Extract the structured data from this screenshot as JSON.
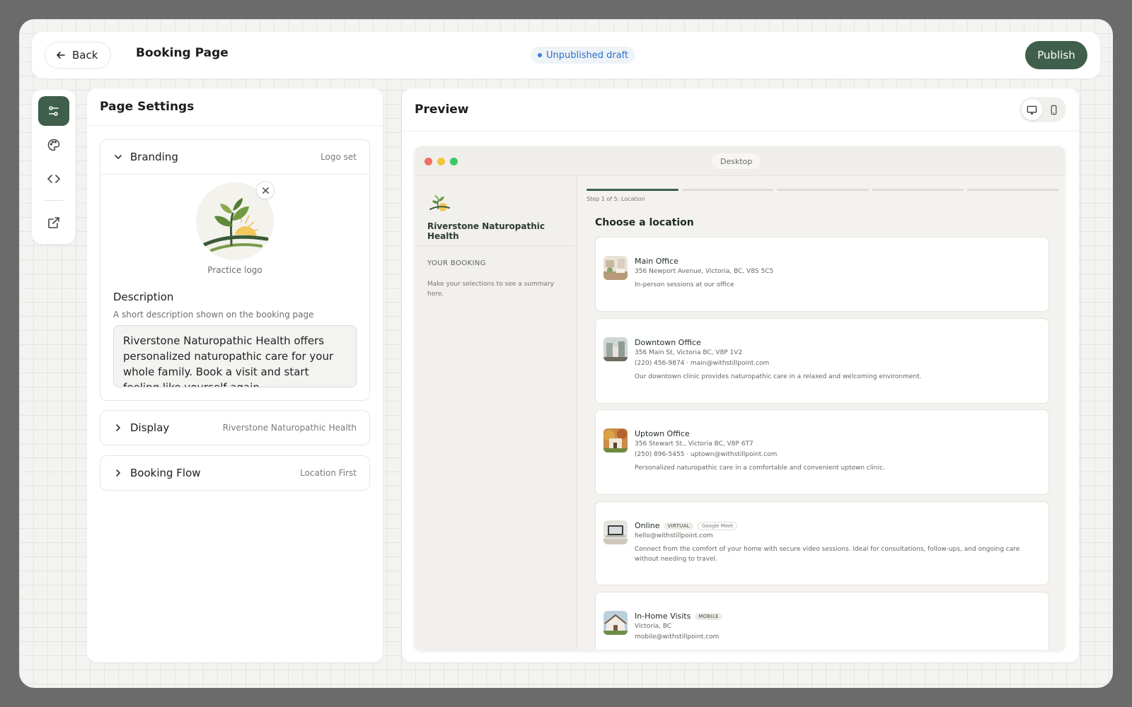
{
  "header": {
    "back_label": "Back",
    "title": "Booking Page",
    "status": "Unpublished draft",
    "publish_label": "Publish"
  },
  "rail": {
    "items": [
      "settings-icon",
      "palette-icon",
      "code-icon",
      "external-link-icon"
    ]
  },
  "settings": {
    "title": "Page Settings",
    "branding": {
      "label": "Branding",
      "meta": "Logo set",
      "logo_caption": "Practice logo",
      "description_label": "Description",
      "description_help": "A short description shown on the booking page",
      "description_value": "Riverstone Naturopathic Health offers personalized naturopathic care for your whole family. Book a visit and start feeling like yourself again."
    },
    "display": {
      "label": "Display",
      "meta": "Riverstone Naturopathic Health"
    },
    "flow": {
      "label": "Booking Flow",
      "meta": "Location First"
    }
  },
  "preview": {
    "title": "Preview",
    "device": "Desktop",
    "booking": {
      "practice_name": "Riverstone Naturopathic Health",
      "your_booking": "YOUR BOOKING",
      "hint": "Make your selections to see a summary here.",
      "step_label": "Step 1 of 5: Location",
      "heading": "Choose a location",
      "locations": [
        {
          "name": "Main Office",
          "line1": "356 Newport Avenue, Victoria, BC, V8S 5C5",
          "line2": "",
          "desc": "In-person sessions at our office"
        },
        {
          "name": "Downtown Office",
          "line1": "356 Main St, Victoria BC, V8P 1V2",
          "line2": "(220) 456-9874 · main@withstillpoint.com",
          "desc": "Our downtown clinic provides naturopathic care in a relaxed and welcoming environment."
        },
        {
          "name": "Uptown Office",
          "line1": "356 Stewart St., Victoria BC, V8P 6T7",
          "line2": "(250) 896-5455 · uptown@withstillpoint.com",
          "desc": "Personalized naturopathic care in a comfortable and convenient uptown clinic."
        },
        {
          "name": "Online",
          "badge": "VIRTUAL",
          "badge2": "Google Meet",
          "line1": "hello@withstillpoint.com",
          "line2": "",
          "desc": "Connect from the comfort of your home with secure video sessions. Ideal for consultations, follow-ups, and ongoing care without needing to travel."
        },
        {
          "name": "In-Home Visits",
          "badge": "MOBILE",
          "line1": "Victoria, BC",
          "line2": "mobile@withstillpoint.com",
          "desc": ""
        }
      ]
    }
  },
  "colors": {
    "brand": "#3f5f4c",
    "status_text": "#2e6fc4",
    "status_bg": "#eef3f8"
  }
}
